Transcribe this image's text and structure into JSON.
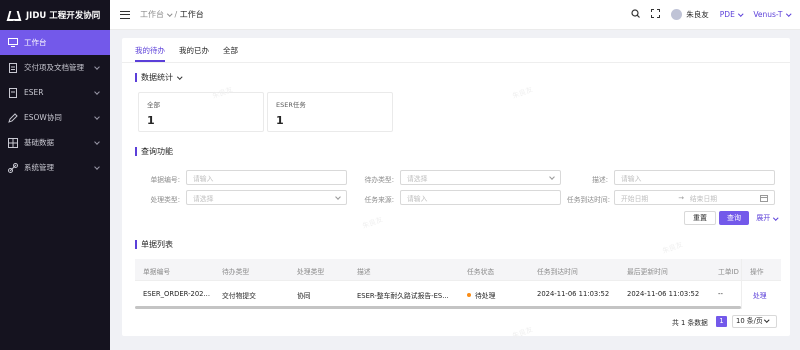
{
  "sidebar": {
    "logo_text": "JIDU 工程开发协同",
    "items": [
      {
        "label": "工作台",
        "icon": "monitor-icon"
      },
      {
        "label": "交付项及文档管理",
        "icon": "document-icon"
      },
      {
        "label": "ESER",
        "icon": "document-icon"
      },
      {
        "label": "ESOW协同",
        "icon": "edit-icon"
      },
      {
        "label": "基础数据",
        "icon": "grid-icon"
      },
      {
        "label": "系统管理",
        "icon": "link-icon"
      }
    ]
  },
  "header": {
    "crumb_parent": "工作台",
    "crumb_current": "工作台",
    "user_name": "朱良友",
    "role": "PDE",
    "project": "Venus-T"
  },
  "tabs": [
    "我的待办",
    "我的已办",
    "全部"
  ],
  "stats": {
    "title": "数据统计",
    "cards": [
      {
        "label": "全部",
        "value": "1"
      },
      {
        "label": "ESER任务",
        "value": "1"
      }
    ]
  },
  "query": {
    "title": "查询功能",
    "fields": {
      "doc_no": {
        "label": "单据编号:",
        "placeholder": "请输入"
      },
      "todo_type": {
        "label": "待办类型:",
        "placeholder": "请选择"
      },
      "desc": {
        "label": "描述:",
        "placeholder": "请输入"
      },
      "process_type": {
        "label": "处理类型:",
        "placeholder": "请选择"
      },
      "source": {
        "label": "任务来源:",
        "placeholder": "请输入"
      },
      "arrive_time": {
        "label": "任务到达时间:",
        "start": "开始日期",
        "end": "结束日期"
      }
    },
    "reset_label": "重置",
    "search_label": "查询",
    "expand_label": "展开"
  },
  "list": {
    "title": "单据列表",
    "columns": [
      "单据编号",
      "待办类型",
      "处理类型",
      "描述",
      "任务状态",
      "任务到达时间",
      "最后更新时间",
      "工单ID",
      "操作"
    ],
    "rows": [
      {
        "doc_no": "ESER_ORDER-202...",
        "todo_type": "交付物提交",
        "process_type": "协同",
        "desc": "ESER-整车耐久路试报告-ES...",
        "status": "待处理",
        "arrive_time": "2024-11-06 11:03:52",
        "update_time": "2024-11-06 11:03:52",
        "ticket_id": "--",
        "action": "处理"
      }
    ]
  },
  "pager": {
    "total_text": "共 1 条数据",
    "page": "1",
    "page_size": "10 条/页"
  },
  "watermark": "朱良友",
  "colors": {
    "accent": "#7359ea",
    "sidebar_bg": "#15131f",
    "status_pending": "#fa8c16"
  }
}
